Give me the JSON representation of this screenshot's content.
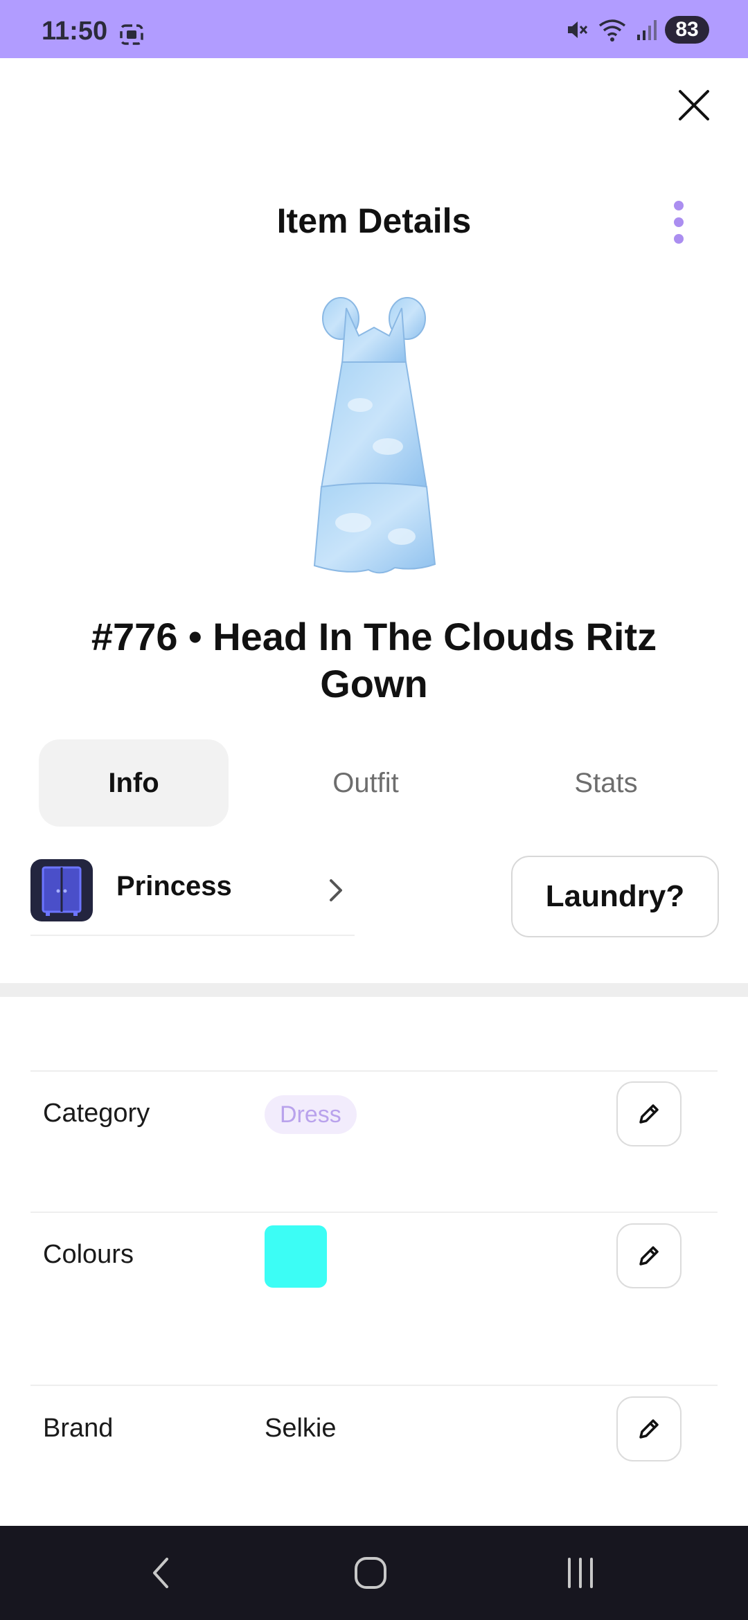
{
  "status_bar": {
    "time": "11:50",
    "battery": "83",
    "icons": [
      "screenshot-icon",
      "mute-icon",
      "wifi-icon",
      "signal-icon"
    ],
    "background": "#b19cff"
  },
  "header": {
    "title": "Item Details",
    "icons": [
      "close-icon",
      "more-vertical-icon"
    ]
  },
  "item": {
    "title": "#776 • Head In The Clouds Ritz Gown"
  },
  "tabs": [
    {
      "label": "Info",
      "active": true
    },
    {
      "label": "Outfit",
      "active": false
    },
    {
      "label": "Stats",
      "active": false
    }
  ],
  "wardrobe": {
    "label": "Princess",
    "icon": "wardrobe-icon"
  },
  "laundry_button": "Laundry?",
  "details": {
    "category": {
      "label": "Category",
      "value": "Dress"
    },
    "colours": {
      "label": "Colours",
      "swatch": "#3cfdf5"
    },
    "brand": {
      "label": "Brand",
      "value": "Selkie"
    }
  },
  "colors": {
    "accent": "#ab8ef0",
    "chip_bg": "#f2ecfc",
    "chip_text": "#b9a2ec"
  },
  "nav_bar": {
    "icons": [
      "back-icon",
      "home-icon",
      "recents-icon"
    ]
  }
}
